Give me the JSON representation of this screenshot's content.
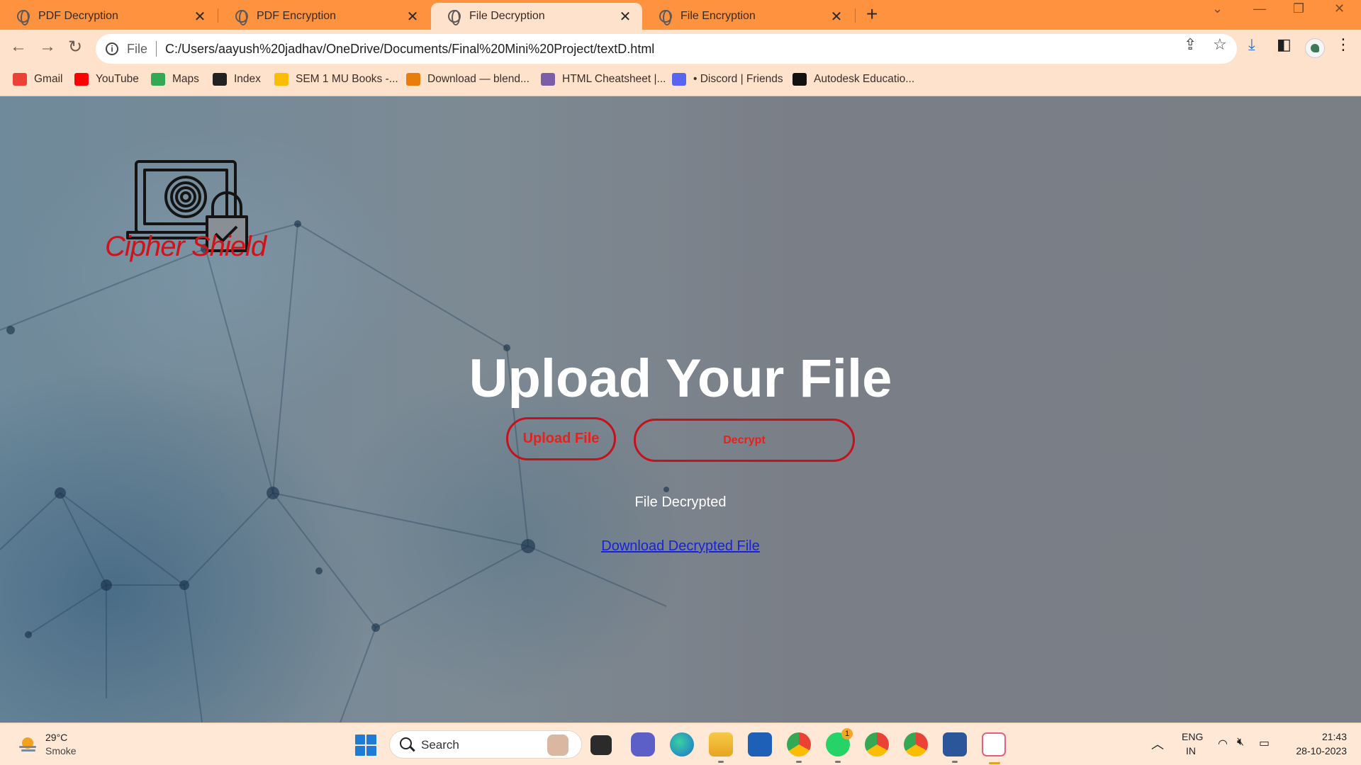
{
  "tabs": [
    {
      "title": "PDF Decryption",
      "active": false
    },
    {
      "title": "PDF Encryption",
      "active": false
    },
    {
      "title": "File Decryption",
      "active": true
    },
    {
      "title": "File Encryption",
      "active": false
    }
  ],
  "address_bar": {
    "scheme_label": "File",
    "url": "C:/Users/aayush%20jadhav/OneDrive/Documents/Final%20Mini%20Project/textD.html"
  },
  "bookmarks": [
    {
      "label": "Gmail",
      "icon": "gmail-icon",
      "color": "#ea4335"
    },
    {
      "label": "YouTube",
      "icon": "youtube-icon",
      "color": "#ff0000"
    },
    {
      "label": "Maps",
      "icon": "maps-icon",
      "color": "#34a853"
    },
    {
      "label": "Index",
      "icon": "index-icon",
      "color": "#222222"
    },
    {
      "label": "SEM 1 MU Books -...",
      "icon": "google-drive-icon",
      "color": "#fbbc04"
    },
    {
      "label": "Download — blend...",
      "icon": "blender-icon",
      "color": "#e87d0d"
    },
    {
      "label": "HTML Cheatsheet |...",
      "icon": "profile-icon",
      "color": "#7b5ea7"
    },
    {
      "label": "• Discord | Friends",
      "icon": "discord-icon",
      "color": "#5865f2"
    },
    {
      "label": "Autodesk Educatio...",
      "icon": "autodesk-icon",
      "color": "#111111"
    }
  ],
  "page": {
    "brand": "Cipher Shield",
    "headline": "Upload Your File",
    "upload_button": "Upload File",
    "decrypt_button": "Decrypt",
    "status": "File Decrypted",
    "download_link": "Download Decrypted File",
    "accent_color": "#d0121b"
  },
  "taskbar": {
    "weather_temp": "29°C",
    "weather_desc": "Smoke",
    "search_label": "Search",
    "whatsapp_badge": "1",
    "lang_primary": "ENG",
    "lang_secondary": "IN",
    "time": "21:43",
    "date": "28-10-2023"
  }
}
